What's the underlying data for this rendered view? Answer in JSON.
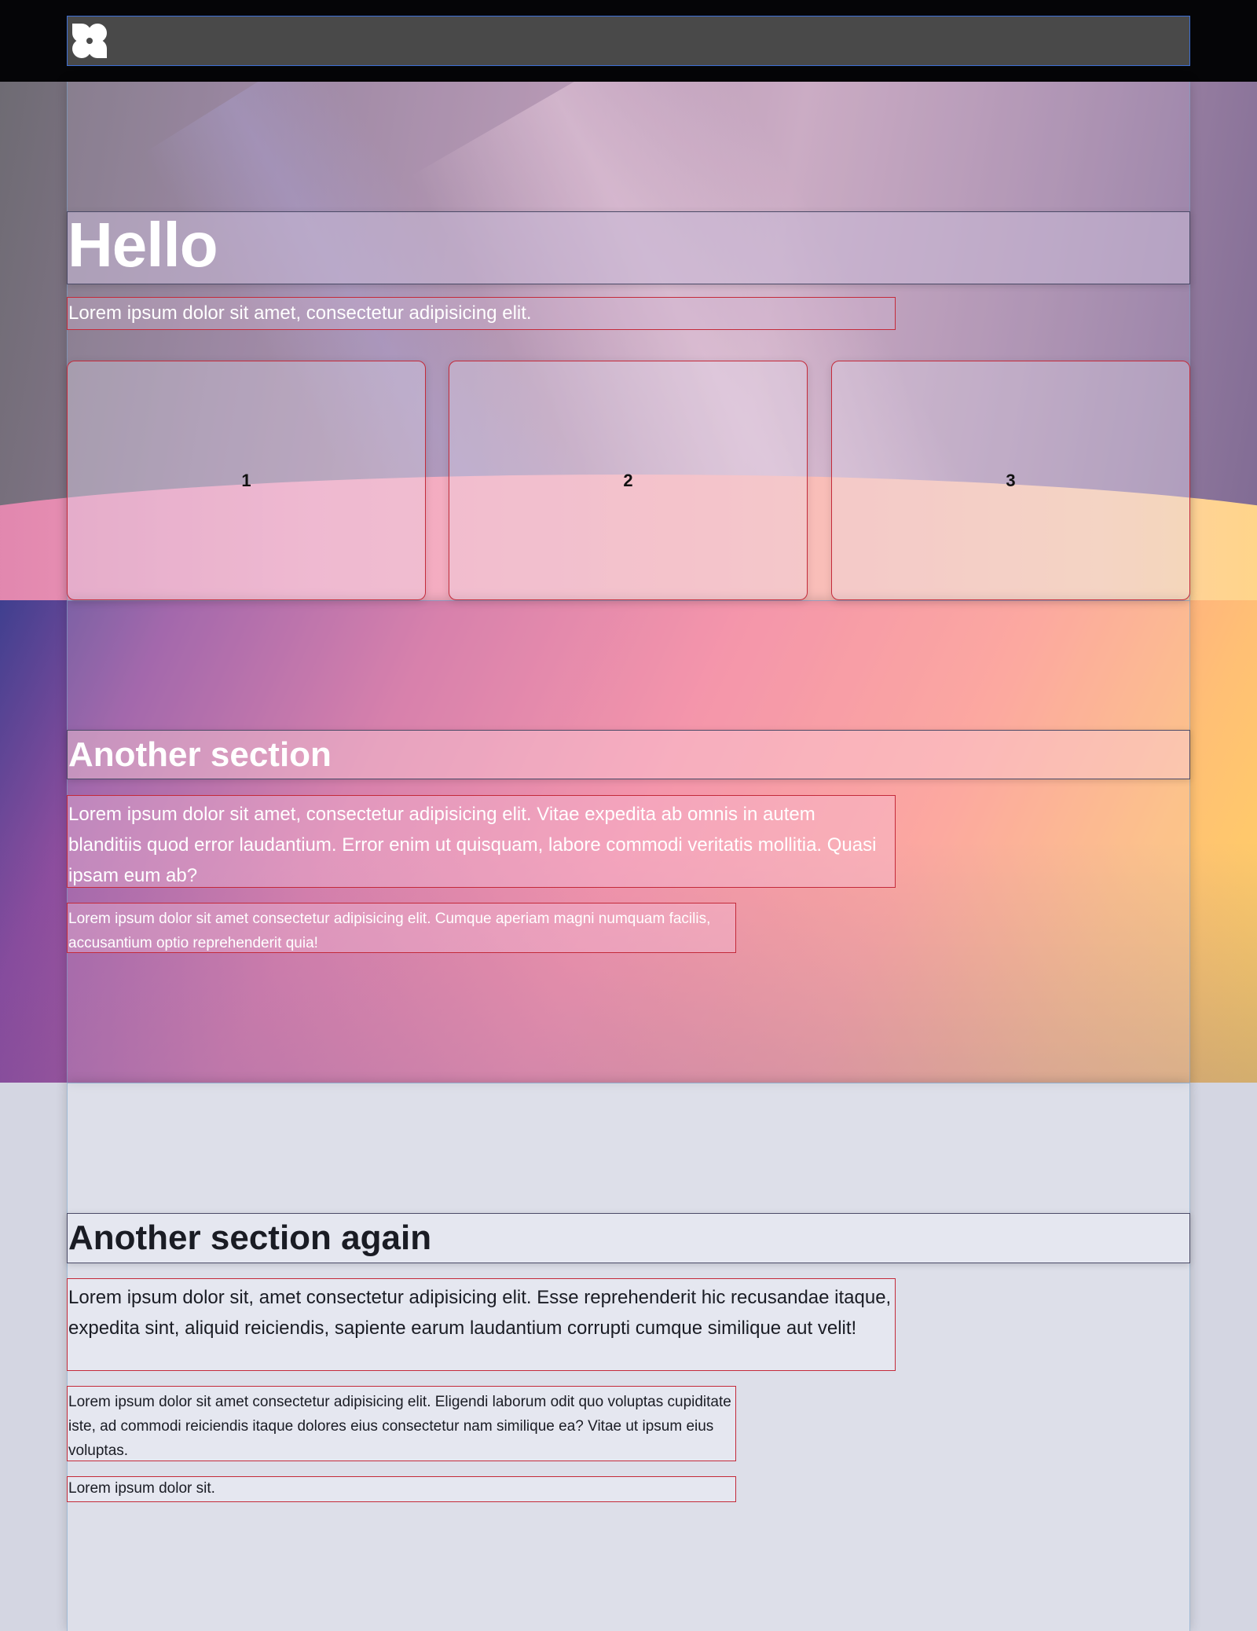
{
  "header": {
    "logo_icon": "clover-logo-icon"
  },
  "hero": {
    "title": "Hello",
    "subtitle": "Lorem ipsum dolor sit amet, consectetur adipisicing elit.",
    "cards": [
      "1",
      "2",
      "3"
    ]
  },
  "section_two": {
    "title": "Another section",
    "paragraph": "Lorem ipsum dolor sit amet, consectetur adipisicing elit. Vitae expedita ab omnis in autem blanditiis quod error laudantium. Error enim ut quisquam, labore commodi veritatis mollitia. Quasi ipsam eum ab?",
    "small_paragraph": "Lorem ipsum dolor sit amet consectetur adipisicing elit. Cumque aperiam magni numquam facilis, accusantium optio reprehenderit quia!"
  },
  "section_three": {
    "title": "Another section again",
    "paragraph": "Lorem ipsum dolor sit, amet consectetur adipisicing elit. Esse reprehenderit hic recusandae itaque, expedita sint, aliquid reiciendis, sapiente earum laudantium corrupti cumque similique aut velit!",
    "small_paragraph": "Lorem ipsum dolor sit amet consectetur adipisicing elit. Eligendi laborum odit quo voluptas cupiditate iste, ad commodi reiciendis itaque dolores eius consectetur nam similique ea? Vitae ut ipsum eius voluptas.",
    "footnote": "Lorem ipsum dolor sit."
  },
  "colors": {
    "topbar": "#050507",
    "debug_outline_red": "#c42a3a",
    "debug_outline_blue": "#3d6fd6"
  }
}
